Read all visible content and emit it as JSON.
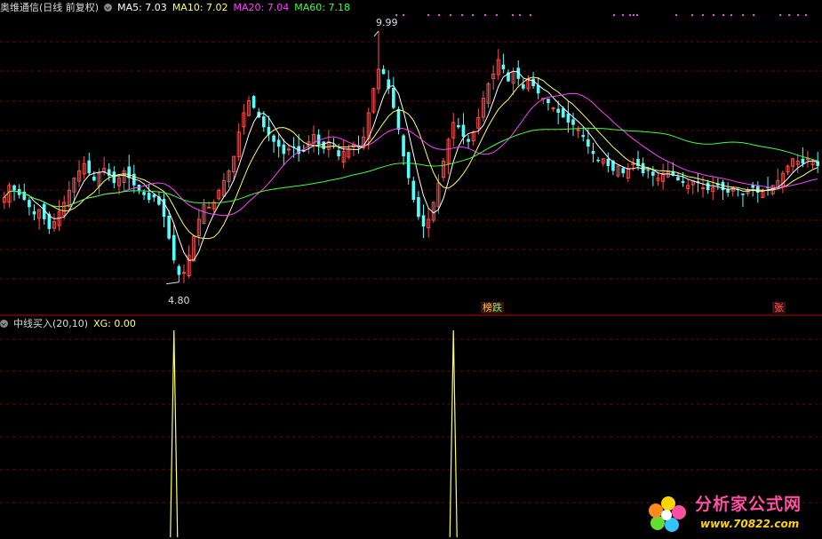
{
  "main_header": {
    "name": "奥维通信(日线 前复权)",
    "ma5": "MA5: 7.03",
    "ma10": "MA10: 7.02",
    "ma20": "MA20: 7.04",
    "ma60": "MA60: 7.18"
  },
  "indicator_header": {
    "name": "中线买入(20,10)",
    "xg": "XG: 0.00"
  },
  "annotations": {
    "high_label": "9.99",
    "low_label": "4.80",
    "tag_bang": "榜",
    "tag_die": "跌",
    "tag_zhang": "张"
  },
  "watermark": {
    "title": "分析家公式网",
    "url": "www.70822.com"
  },
  "colors": {
    "up": "#ff5050",
    "down": "#54ffff",
    "ma5": "#ffffff",
    "ma10": "#ffff66",
    "ma20": "#ff40ff",
    "ma60": "#40ff40",
    "grid": "#7a0000",
    "divider": "#a00000",
    "signal": "#ffff66",
    "marker": "#ff40ff"
  },
  "chart_data": [
    {
      "type": "candlestick",
      "title": "奥维通信(日线 前复权)",
      "ylim": [
        4.3,
        10.3
      ],
      "y_high": 9.99,
      "y_low": 4.8,
      "series": [
        {
          "name": "MA5",
          "last": 7.03
        },
        {
          "name": "MA10",
          "last": 7.02
        },
        {
          "name": "MA20",
          "last": 7.04
        },
        {
          "name": "MA60",
          "last": 7.18
        }
      ],
      "close": [
        6.55,
        6.8,
        6.7,
        6.6,
        6.5,
        6.35,
        6.2,
        6.3,
        6.1,
        5.9,
        6.05,
        6.25,
        6.45,
        6.7,
        6.95,
        7.1,
        7.25,
        7.05,
        6.9,
        7.05,
        7.15,
        7.0,
        6.85,
        6.95,
        7.1,
        6.95,
        6.8,
        6.7,
        6.6,
        6.5,
        6.55,
        6.4,
        6.15,
        5.7,
        5.25,
        4.95,
        5.0,
        5.35,
        5.75,
        6.1,
        6.4,
        6.35,
        6.45,
        6.7,
        6.9,
        7.1,
        7.4,
        7.9,
        8.3,
        8.55,
        8.4,
        8.2,
        8.0,
        7.85,
        7.7,
        7.6,
        7.45,
        7.55,
        7.6,
        7.45,
        7.5,
        7.7,
        7.85,
        7.65,
        7.55,
        7.7,
        7.6,
        7.4,
        7.5,
        7.55,
        7.65,
        7.6,
        7.8,
        8.3,
        8.8,
        9.2,
        9.1,
        8.8,
        8.4,
        7.95,
        7.4,
        6.95,
        6.5,
        6.15,
        5.95,
        6.1,
        6.45,
        6.85,
        7.3,
        7.75,
        8.1,
        8.0,
        7.8,
        7.7,
        7.9,
        8.2,
        8.6,
        8.9,
        9.1,
        9.4,
        9.2,
        8.95,
        9.15,
        9.0,
        8.8,
        9.0,
        8.85,
        8.7,
        8.6,
        8.5,
        8.4,
        8.3,
        8.2,
        8.1,
        8.05,
        7.95,
        7.8,
        7.6,
        7.45,
        7.3,
        7.35,
        7.2,
        7.1,
        7.2,
        7.05,
        7.15,
        7.25,
        7.2,
        7.05,
        7.1,
        7.0,
        6.95,
        7.05,
        7.1,
        7.0,
        6.9,
        6.85,
        6.8,
        6.9,
        6.85,
        6.75,
        6.7,
        6.75,
        6.8,
        6.7,
        6.65,
        6.75,
        6.7,
        6.6,
        6.7,
        6.75,
        6.65,
        6.7,
        6.75,
        6.8,
        6.9,
        7.05,
        7.2,
        7.35,
        7.3,
        7.25,
        7.35,
        7.3,
        7.2
      ],
      "high_label": "9.99",
      "low_label": "4.80"
    },
    {
      "type": "line",
      "title": "中线买入(20,10)",
      "series": [
        {
          "name": "XG",
          "last": 0.0
        }
      ],
      "signal_indices": [
        34,
        90
      ],
      "signal_value": 1,
      "ylim": [
        0,
        1.0
      ]
    }
  ]
}
